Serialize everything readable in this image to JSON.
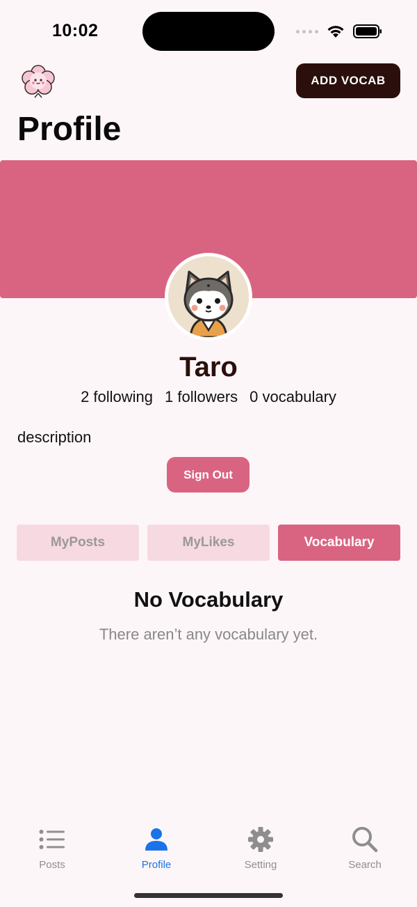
{
  "status_bar": {
    "time": "10:02"
  },
  "header": {
    "add_vocab_label": "ADD VOCAB",
    "title": "Profile"
  },
  "colors": {
    "accent": "#d96482",
    "accent_light": "#f7d9e2",
    "dark_button": "#2a0f0c",
    "active_tab": "#1a73e8",
    "background": "#fdf6f9"
  },
  "profile": {
    "name": "Taro",
    "following": "2 following",
    "followers": "1 followers",
    "vocabulary": "0 vocabulary",
    "description": "description",
    "sign_out_label": "Sign Out"
  },
  "tabs": [
    {
      "label": "MyPosts",
      "active": false
    },
    {
      "label": "MyLikes",
      "active": false
    },
    {
      "label": "Vocabulary",
      "active": true
    }
  ],
  "empty_state": {
    "title": "No Vocabulary",
    "subtitle": "There aren’t any vocabulary yet."
  },
  "tab_bar": [
    {
      "label": "Posts",
      "icon": "list-icon",
      "active": false
    },
    {
      "label": "Profile",
      "icon": "person-icon",
      "active": true
    },
    {
      "label": "Setting",
      "icon": "gear-icon",
      "active": false
    },
    {
      "label": "Search",
      "icon": "search-icon",
      "active": false
    }
  ]
}
